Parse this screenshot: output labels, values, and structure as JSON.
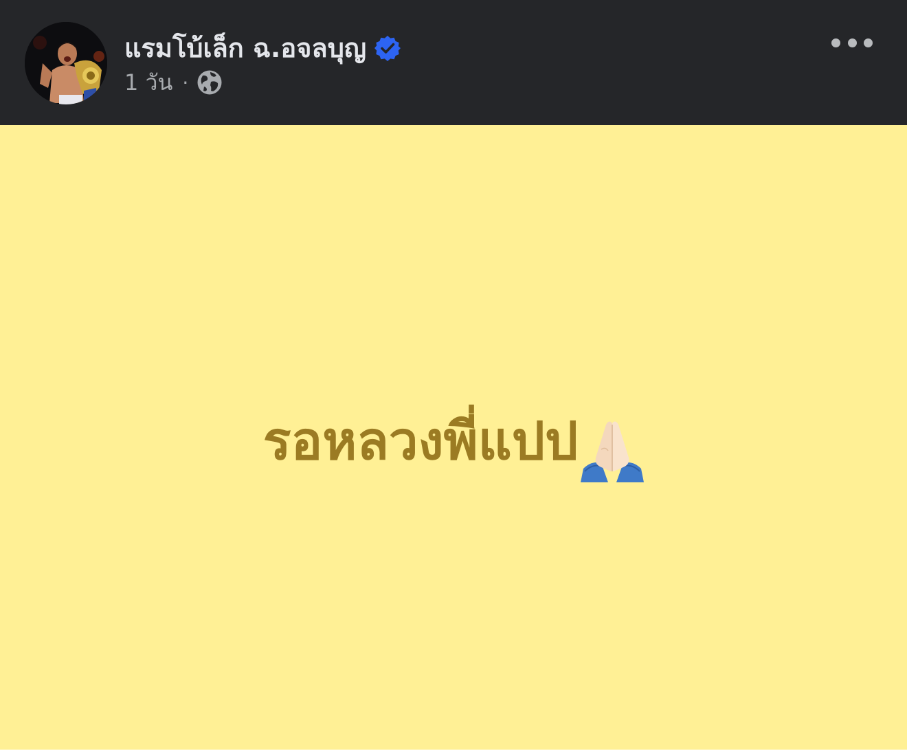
{
  "author": {
    "name": "แรมโบ้เล็ก ฉ.อจลบุญ",
    "verified_icon": "verified-badge-icon",
    "avatar_icon": "profile-avatar"
  },
  "meta": {
    "time": "1 วัน",
    "separator": "·",
    "audience_icon": "globe-icon"
  },
  "post": {
    "text": "รอหลวงพี่แปป",
    "emoji_icon": "folded-hands-emoji"
  },
  "colors": {
    "header_bg": "#252629",
    "background_card": "#FFF095",
    "post_text": "#9B7B23",
    "verified": "#2D64F2",
    "name_text": "#E4E6EB",
    "meta_text": "#A8ABAF"
  }
}
